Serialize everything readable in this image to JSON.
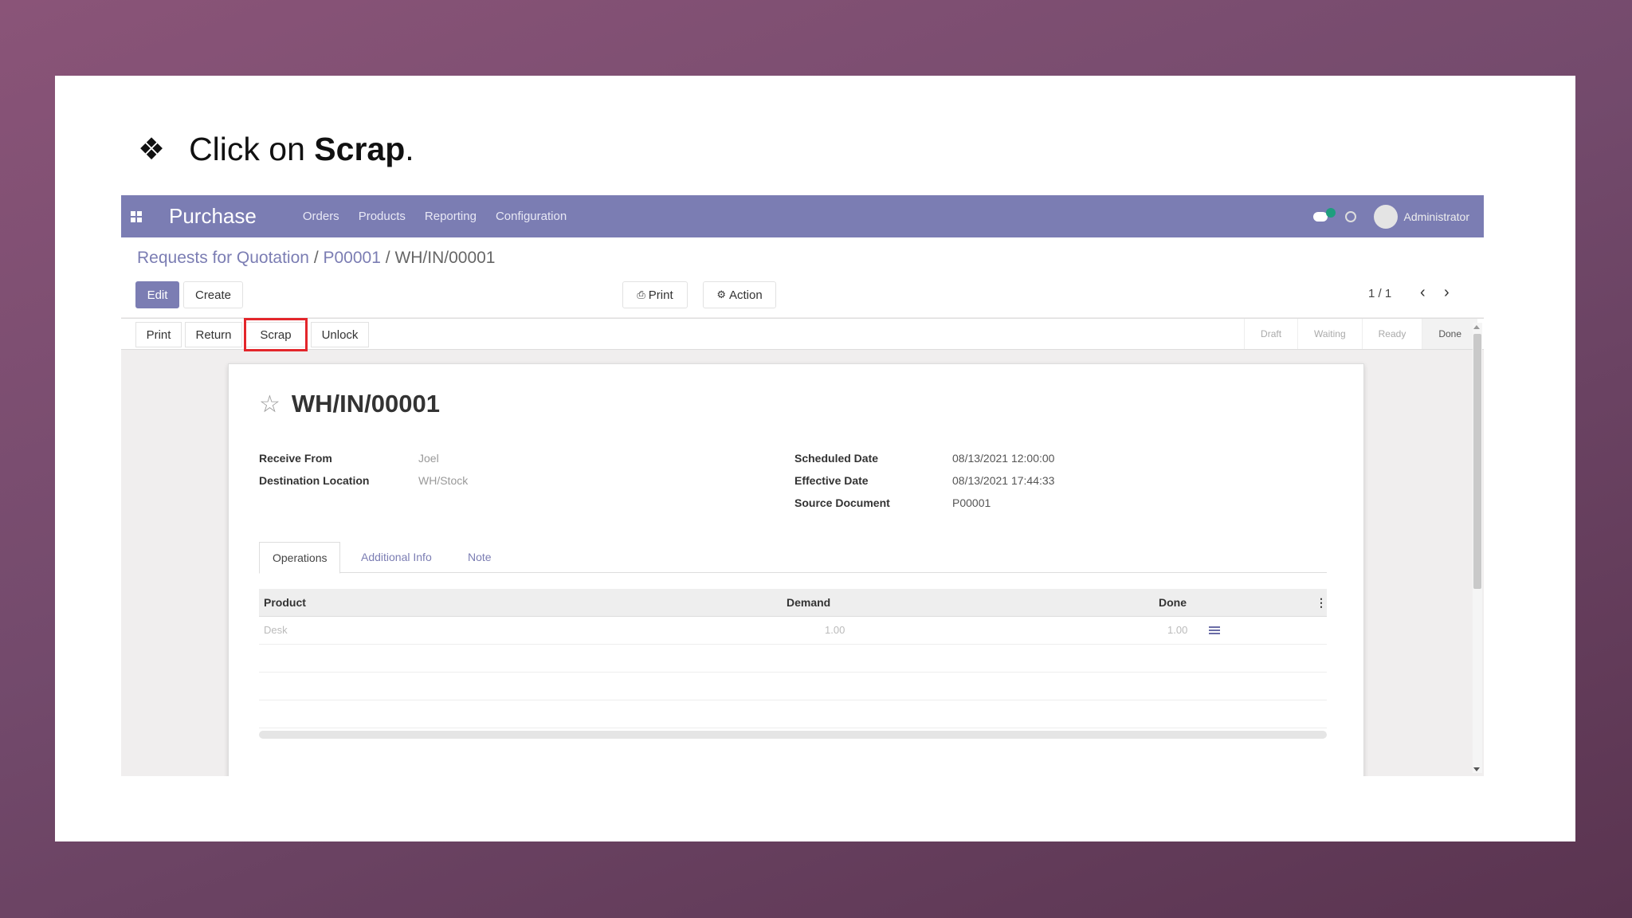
{
  "instruction": {
    "bullet": "❖",
    "prefix": "Click on ",
    "bold": "Scrap",
    "suffix": "."
  },
  "navbar": {
    "app_title": "Purchase",
    "menu": [
      "Orders",
      "Products",
      "Reporting",
      "Configuration"
    ],
    "chat_badge": "1",
    "user": "Administrator"
  },
  "breadcrumb": {
    "items": [
      "Requests for Quotation",
      "P00001",
      "WH/IN/00001"
    ],
    "separator": "/"
  },
  "control_panel": {
    "edit_label": "Edit",
    "create_label": "Create",
    "print_label": "Print",
    "action_label": "Action",
    "pager": "1 / 1"
  },
  "statusbar": {
    "buttons": [
      "Print",
      "Return",
      "Scrap",
      "Unlock"
    ],
    "stages": [
      "Draft",
      "Waiting",
      "Ready",
      "Done"
    ],
    "active_stage": "Done"
  },
  "record": {
    "name": "WH/IN/00001",
    "left_fields": [
      {
        "label": "Receive From",
        "value": "Joel"
      },
      {
        "label": "Destination Location",
        "value": "WH/Stock"
      }
    ],
    "right_fields": [
      {
        "label": "Scheduled Date",
        "value": "08/13/2021 12:00:00"
      },
      {
        "label": "Effective Date",
        "value": "08/13/2021 17:44:33"
      },
      {
        "label": "Source Document",
        "value": "P00001"
      }
    ]
  },
  "tabs": [
    "Operations",
    "Additional Info",
    "Note"
  ],
  "table": {
    "headers": {
      "product": "Product",
      "demand": "Demand",
      "done": "Done"
    },
    "rows": [
      {
        "product": "Desk",
        "demand": "1.00",
        "done": "1.00"
      }
    ]
  },
  "colors": {
    "navbar": "#7b7db3",
    "highlight": "#e3262b",
    "background": "#734a6c"
  }
}
